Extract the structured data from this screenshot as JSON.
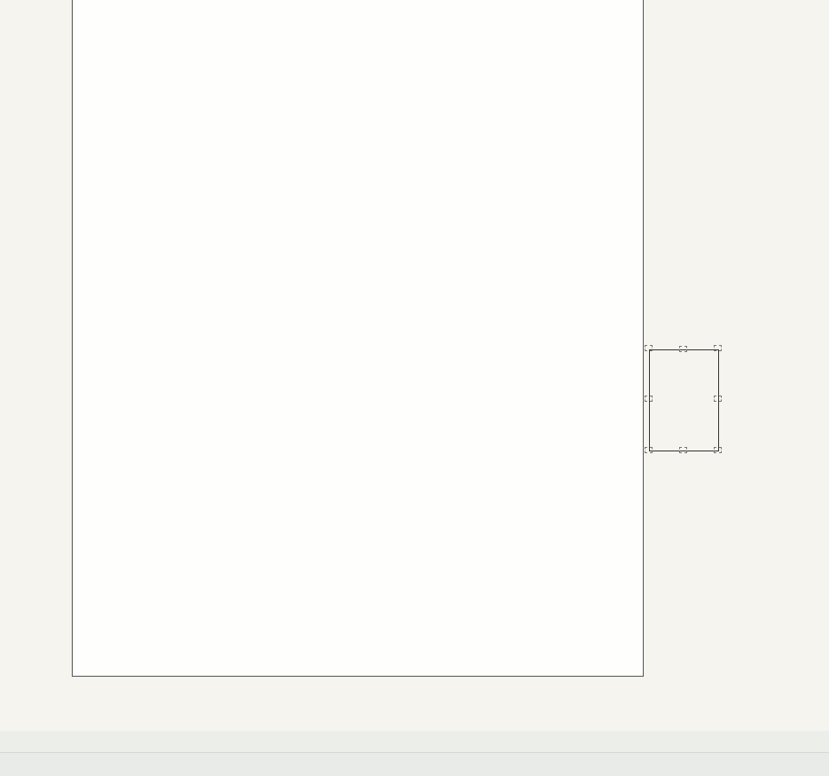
{
  "canvas": {
    "page_label": "",
    "selected_object_label": ""
  },
  "status_bar": {
    "text": ""
  }
}
